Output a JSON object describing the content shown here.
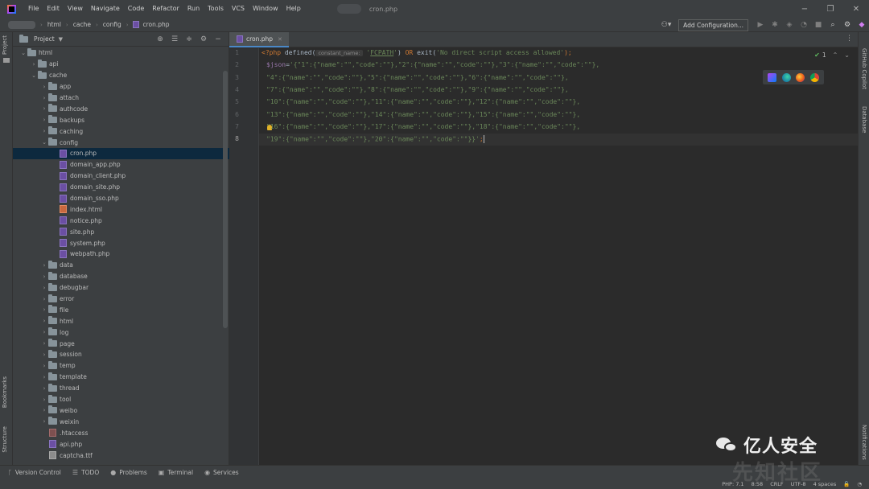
{
  "menubar": {
    "items": [
      "File",
      "Edit",
      "View",
      "Navigate",
      "Code",
      "Refactor",
      "Run",
      "Tools",
      "VCS",
      "Window",
      "Help"
    ],
    "window_title": "cron.php"
  },
  "navbar": {
    "breadcrumbs": [
      "html",
      "cache",
      "config",
      "cron.php"
    ],
    "add_configuration": "Add Configuration..."
  },
  "left_strip": {
    "project": "Project",
    "bookmarks": "Bookmarks",
    "structure": "Structure"
  },
  "right_strip": {
    "copilot": "GitHub Copilot",
    "database": "Database",
    "notifications": "Notifications"
  },
  "project_panel": {
    "title": "Project",
    "tree": [
      {
        "label": "html",
        "type": "folder",
        "depth": 1,
        "expanded": true
      },
      {
        "label": "api",
        "type": "folder",
        "depth": 2,
        "expanded": false
      },
      {
        "label": "cache",
        "type": "folder",
        "depth": 2,
        "expanded": true
      },
      {
        "label": "app",
        "type": "folder",
        "depth": 3,
        "expanded": false
      },
      {
        "label": "attach",
        "type": "folder",
        "depth": 3,
        "expanded": false
      },
      {
        "label": "authcode",
        "type": "folder",
        "depth": 3,
        "expanded": false
      },
      {
        "label": "backups",
        "type": "folder",
        "depth": 3,
        "expanded": false
      },
      {
        "label": "caching",
        "type": "folder",
        "depth": 3,
        "expanded": false
      },
      {
        "label": "config",
        "type": "folder",
        "depth": 3,
        "expanded": true
      },
      {
        "label": "cron.php",
        "type": "php",
        "depth": 4,
        "selected": true
      },
      {
        "label": "domain_app.php",
        "type": "php",
        "depth": 4
      },
      {
        "label": "domain_client.php",
        "type": "php",
        "depth": 4
      },
      {
        "label": "domain_site.php",
        "type": "php",
        "depth": 4
      },
      {
        "label": "domain_sso.php",
        "type": "php",
        "depth": 4
      },
      {
        "label": "index.html",
        "type": "html",
        "depth": 4
      },
      {
        "label": "notice.php",
        "type": "php",
        "depth": 4
      },
      {
        "label": "site.php",
        "type": "php",
        "depth": 4
      },
      {
        "label": "system.php",
        "type": "php",
        "depth": 4
      },
      {
        "label": "webpath.php",
        "type": "php",
        "depth": 4
      },
      {
        "label": "data",
        "type": "folder",
        "depth": 3,
        "expanded": false
      },
      {
        "label": "database",
        "type": "folder",
        "depth": 3,
        "expanded": false
      },
      {
        "label": "debugbar",
        "type": "folder",
        "depth": 3,
        "expanded": false
      },
      {
        "label": "error",
        "type": "folder",
        "depth": 3,
        "expanded": false
      },
      {
        "label": "file",
        "type": "folder",
        "depth": 3,
        "expanded": false
      },
      {
        "label": "html",
        "type": "folder",
        "depth": 3,
        "expanded": false
      },
      {
        "label": "log",
        "type": "folder",
        "depth": 3,
        "expanded": false
      },
      {
        "label": "page",
        "type": "folder",
        "depth": 3,
        "expanded": false
      },
      {
        "label": "session",
        "type": "folder",
        "depth": 3,
        "expanded": false
      },
      {
        "label": "temp",
        "type": "folder",
        "depth": 3,
        "expanded": false
      },
      {
        "label": "template",
        "type": "folder",
        "depth": 3,
        "expanded": false
      },
      {
        "label": "thread",
        "type": "folder",
        "depth": 3,
        "expanded": false
      },
      {
        "label": "tool",
        "type": "folder",
        "depth": 3,
        "expanded": false
      },
      {
        "label": "weibo",
        "type": "folder",
        "depth": 3,
        "expanded": false
      },
      {
        "label": "weixin",
        "type": "folder",
        "depth": 3,
        "expanded": false
      },
      {
        "label": ".htaccess",
        "type": "ht",
        "depth": 3
      },
      {
        "label": "api.php",
        "type": "php",
        "depth": 3
      },
      {
        "label": "captcha.ttf",
        "type": "plain",
        "depth": 3
      }
    ]
  },
  "editor": {
    "tab_label": "cron.php",
    "inspections_count": "1",
    "line_numbers": [
      "1",
      "2",
      "3",
      "4",
      "5",
      "6",
      "7",
      "8"
    ],
    "current_line": "8",
    "lines": [
      [
        {
          "t": "<?php ",
          "c": "kw"
        },
        {
          "t": "defined(",
          "c": "fn"
        },
        {
          "t": "constant_name:",
          "c": "hint"
        },
        {
          "t": " ",
          "c": "fn"
        },
        {
          "t": "'",
          "c": "str"
        },
        {
          "t": "FCPATH",
          "c": "str uline"
        },
        {
          "t": "'",
          "c": "str"
        },
        {
          "t": ") ",
          "c": "fn"
        },
        {
          "t": "OR ",
          "c": "kw"
        },
        {
          "t": "exit(",
          "c": "fn"
        },
        {
          "t": "'No direct script access allowed'",
          "c": "str"
        },
        {
          "t": ");",
          "c": "kw"
        }
      ],
      [
        {
          "t": "$json",
          "c": "var"
        },
        {
          "t": "=",
          "c": "fn"
        },
        {
          "t": "'{\"1\":{\"name\":\"\",\"code\":\"\"},\"2\":{\"name\":\"\",\"code\":\"\"},\"3\":{\"name\":\"\",\"code\":\"\"},",
          "c": "str"
        }
      ],
      [
        {
          "t": "\"4\":{\"name\":\"\",\"code\":\"\"},\"5\":{\"name\":\"\",\"code\":\"\"},\"6\":{\"name\":\"\",\"code\":\"\"},",
          "c": "str"
        }
      ],
      [
        {
          "t": "\"7\":{\"name\":\"\",\"code\":\"\"},\"8\":{\"name\":\"\",\"code\":\"\"},\"9\":{\"name\":\"\",\"code\":\"\"},",
          "c": "str"
        }
      ],
      [
        {
          "t": "\"10\":{\"name\":\"\",\"code\":\"\"},\"11\":{\"name\":\"\",\"code\":\"\"},\"12\":{\"name\":\"\",\"code\":\"\"},",
          "c": "str"
        }
      ],
      [
        {
          "t": "\"13\":{\"name\":\"\",\"code\":\"\"},\"14\":{\"name\":\"\",\"code\":\"\"},\"15\":{\"name\":\"\",\"code\":\"\"},",
          "c": "str"
        }
      ],
      [
        {
          "t": "\"16\":{\"name\":\"\",\"code\":\"\"},\"17\":{\"name\":\"\",\"code\":\"\"},\"18\":{\"name\":\"\",\"code\":\"\"},",
          "c": "str"
        }
      ],
      [
        {
          "t": "\"19\":{\"name\":\"\",\"code\":\"\"},\"20\":{\"name\":\"\",\"code\":\"\"}}'",
          "c": "str"
        },
        {
          "t": ";",
          "c": "kw"
        }
      ]
    ]
  },
  "toolwindows": [
    "Version Control",
    "TODO",
    "Problems",
    "Terminal",
    "Services"
  ],
  "statusbar": [
    "PHP: 7.1",
    "8:58",
    "CRLF",
    "UTF-8",
    "4 spaces"
  ],
  "watermark": {
    "text": "亿人安全",
    "sub": "先知社区"
  },
  "colors": {
    "accent": "#4a88c7",
    "keyword": "#cc7832",
    "string": "#6a8759",
    "variable": "#9876aa",
    "selection": "#0d293e"
  }
}
